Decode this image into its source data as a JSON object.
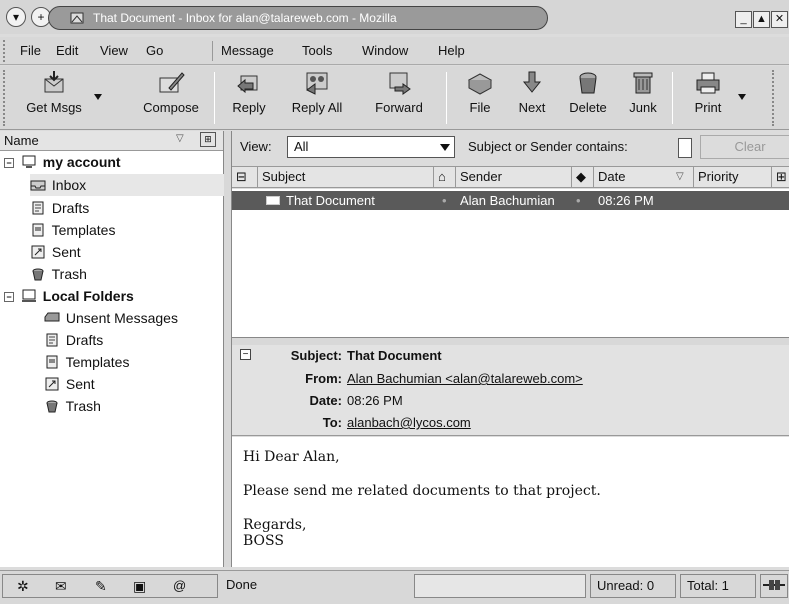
{
  "window": {
    "title": "That Document - Inbox for alan@talareweb.com - Mozilla"
  },
  "menubar": [
    "File",
    "Edit",
    "View",
    "Go",
    "Message",
    "Tools",
    "Window",
    "Help"
  ],
  "toolbar": {
    "get_msgs": "Get Msgs",
    "compose": "Compose",
    "reply": "Reply",
    "reply_all": "Reply All",
    "forward": "Forward",
    "file": "File",
    "next": "Next",
    "delete": "Delete",
    "junk": "Junk",
    "print": "Print"
  },
  "folder_pane": {
    "header": "Name",
    "accounts": [
      {
        "name": "my account",
        "folders": [
          "Inbox",
          "Drafts",
          "Templates",
          "Sent",
          "Trash"
        ]
      },
      {
        "name": "Local Folders",
        "folders": [
          "Unsent Messages",
          "Drafts",
          "Templates",
          "Sent",
          "Trash"
        ]
      }
    ],
    "selected": "Inbox"
  },
  "view_bar": {
    "view_label": "View:",
    "view_value": "All",
    "search_label": "Subject or Sender contains:",
    "search_value": "",
    "clear_label": "Clear"
  },
  "thread_pane": {
    "columns": [
      "Subject",
      "Sender",
      "Date",
      "Priority"
    ],
    "rows": [
      {
        "subject": "That Document",
        "sender": "Alan Bachumian",
        "date": "08:26 PM"
      }
    ]
  },
  "message": {
    "labels": {
      "subject": "Subject:",
      "from": "From:",
      "date": "Date:",
      "to": "To:"
    },
    "subject": "That Document",
    "from": "Alan Bachumian <alan@talareweb.com>",
    "date": "08:26 PM",
    "to": "alanbach@lycos.com",
    "body": {
      "greeting": "Hi Dear Alan,",
      "line1": "Please send me related documents to that project.",
      "closing": "Regards,",
      "signature": "BOSS"
    }
  },
  "statusbar": {
    "status": "Done",
    "unread": "Unread: 0",
    "total": "Total: 1"
  },
  "colors": {
    "selected_row": "#5a5a5a",
    "title_pill": "#9a9a9a"
  }
}
